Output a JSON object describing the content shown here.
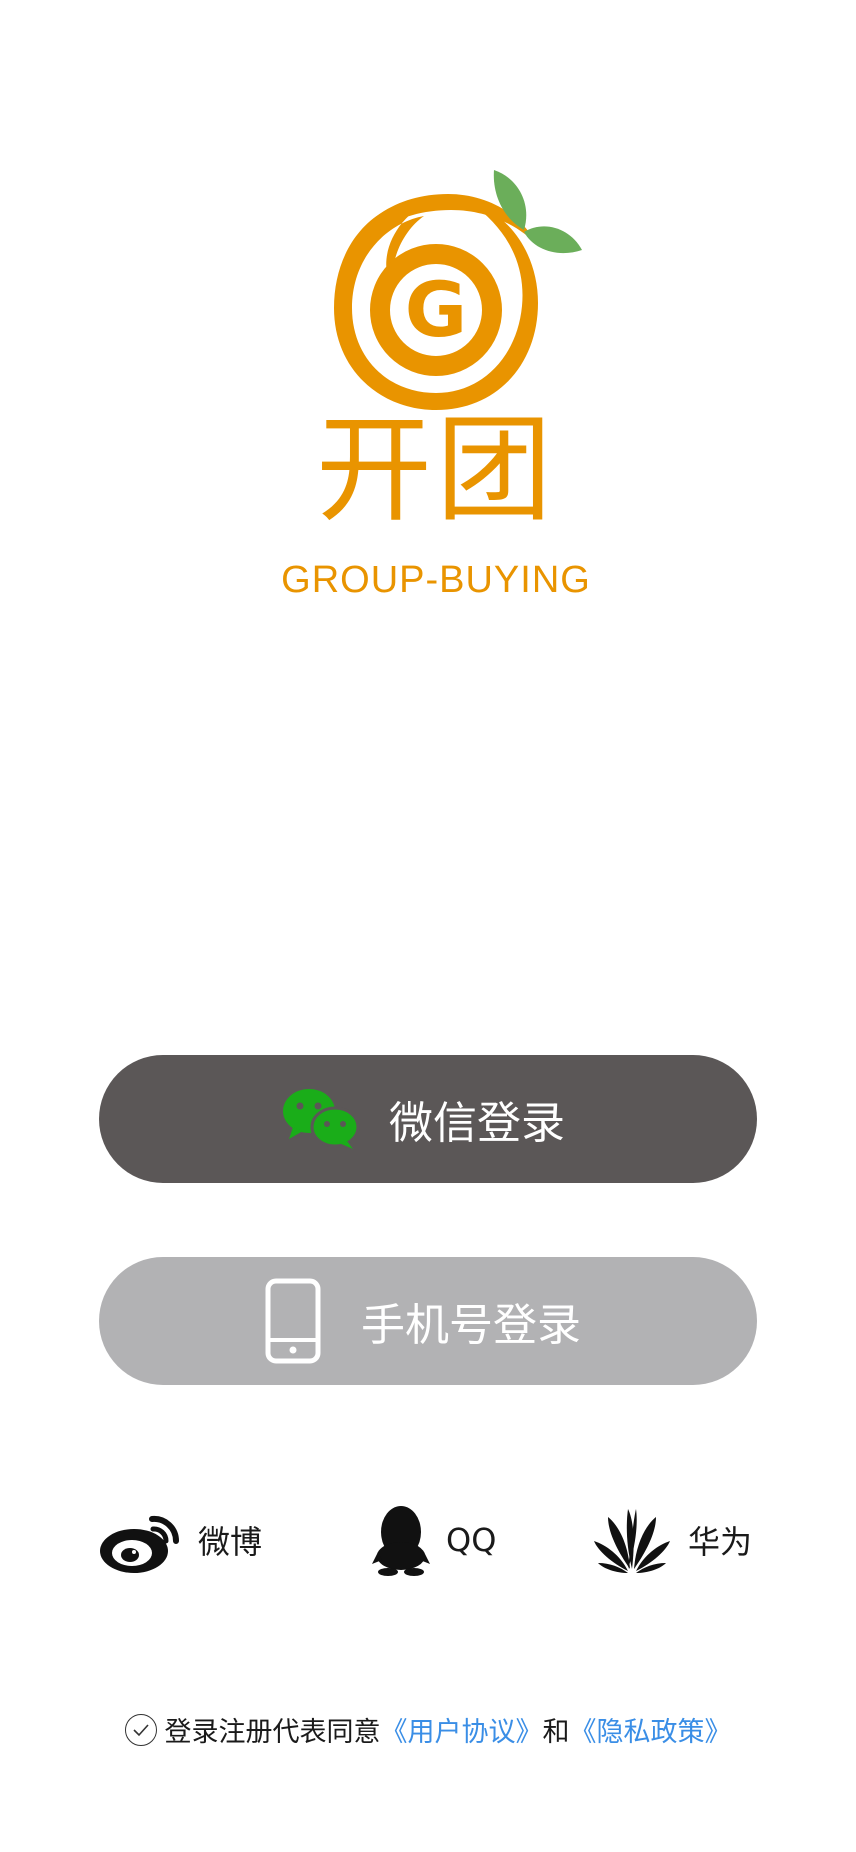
{
  "brand": {
    "name_cn": "开团",
    "name_en": "GROUP-BUYING",
    "logo_letter": "G",
    "primary_color": "#E99400",
    "leaf_color": "#6BAE5A"
  },
  "buttons": {
    "wechat_label": "微信登录",
    "phone_label": "手机号登录",
    "wechat_bg": "#5B5757",
    "phone_bg": "#B2B2B4",
    "wechat_icon_color": "#1AAD19"
  },
  "social": {
    "weibo": {
      "label": "微博",
      "icon": "weibo-icon"
    },
    "qq": {
      "label": "QQ",
      "icon": "qq-icon"
    },
    "huawei": {
      "label": "华为",
      "icon": "huawei-icon"
    }
  },
  "agreement": {
    "prefix": "登录注册代表同意",
    "user_agreement": "《用户协议》",
    "conjunction": "和",
    "privacy_policy": "《隐私政策》",
    "link_color": "#3A8EE6"
  }
}
